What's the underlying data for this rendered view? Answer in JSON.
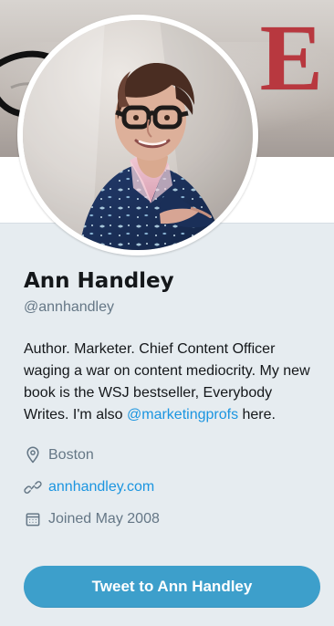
{
  "profile": {
    "name": "Ann Handley",
    "handle": "@annhandley",
    "bio_before_link": "Author. Marketer. Chief Content Officer waging a war on content mediocrity. My new book is the WSJ bestseller, Everybody Writes. I'm also ",
    "bio_link": "@marketingprofs",
    "bio_after_link": " here.",
    "location": "Boston",
    "website": "annhandley.com",
    "joined": "Joined May 2008"
  },
  "banner": {
    "letters": "E"
  },
  "actions": {
    "tweet_button_label": "Tweet to Ann Handley"
  },
  "icons": {
    "location": "location-pin-icon",
    "website": "link-icon",
    "joined": "calendar-icon"
  },
  "colors": {
    "background": "#e6ecf0",
    "link": "#1b95e0",
    "secondary_text": "#657786",
    "button": "#3d9fcb",
    "banner_accent": "#b8383f"
  }
}
